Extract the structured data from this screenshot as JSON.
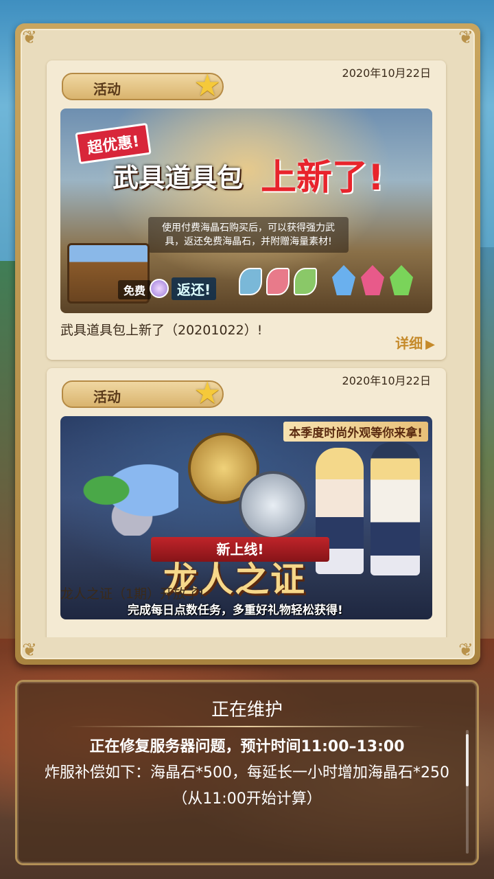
{
  "news": {
    "items": [
      {
        "tag": "活动",
        "date": "2020年10月22日",
        "banner": {
          "badge": "超优惠!",
          "headline_a": "武具道具包",
          "headline_b": "上新了!",
          "description": "使用付费海晶石购买后，可以获得强力武具，返还免费海晶石，并附赠海量素材!",
          "free_label": "免费",
          "return_label": "返还!"
        },
        "title": "武具道具包上新了（20201022）!",
        "detail_label": "详细"
      },
      {
        "tag": "活动",
        "date": "2020年10月22日",
        "banner": {
          "top_label": "本季度时尚外观等你来拿!",
          "ribbon": "新上线!",
          "headline": "龙人之证",
          "subtitle": "完成每日点数任务，多重好礼物轻松获得!"
        },
        "title": "龙人之证（1期）开放了!"
      }
    ]
  },
  "maintenance": {
    "title": "正在维护",
    "line1": "正在修复服务器问题，预计时间11:00–13:00",
    "line2": "炸服补偿如下：海晶石*500，每延长一小时增加海晶石*250",
    "line3": "（从11:00开始计算）"
  },
  "colors": {
    "accent_gold": "#c58a2a",
    "frame_gold": "#b9924a",
    "card_bg": "#f4ead3",
    "alert_red": "#e8242c"
  }
}
